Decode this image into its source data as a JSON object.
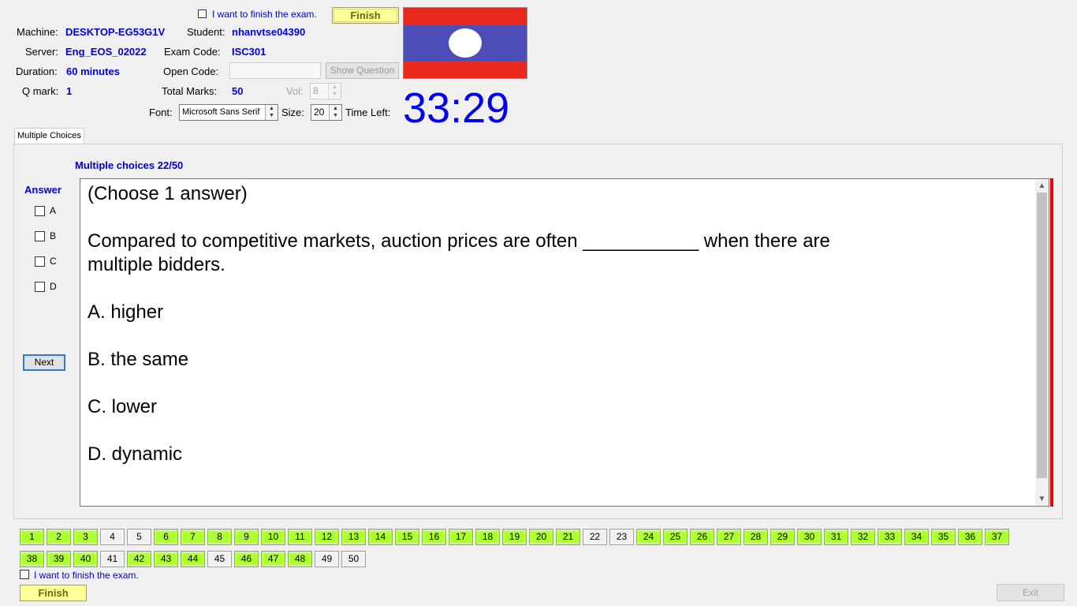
{
  "header": {
    "finish_checkbox_label": "I want to finish the exam.",
    "finish_label": "Finish",
    "machine_label": "Machine:",
    "machine_value": "DESKTOP-EG53G1V",
    "student_label": "Student:",
    "student_value": "nhanvtse04390",
    "server_label": "Server:",
    "server_value": "Eng_EOS_02022",
    "exam_code_label": "Exam Code:",
    "exam_code_value": "ISC301",
    "duration_label": "Duration:",
    "duration_value": "60 minutes",
    "open_code_label": "Open Code:",
    "open_code_value": "",
    "show_question_label": "Show Question",
    "q_mark_label": "Q mark:",
    "q_mark_value": "1",
    "total_marks_label": "Total Marks:",
    "total_marks_value": "50",
    "vol_label": "Vol:",
    "vol_value": "8",
    "font_label": "Font:",
    "font_value": "Microsoft Sans Serif",
    "size_label": "Size:",
    "size_value": "20",
    "time_left_label": "Time Left:",
    "timer": "33:29"
  },
  "tab": {
    "label": "Multiple Choices"
  },
  "question_panel": {
    "progress": "Multiple choices 22/50",
    "answer_title": "Answer",
    "answer_options": [
      "A",
      "B",
      "C",
      "D"
    ],
    "next_label": "Next",
    "instruction": "(Choose 1 answer)",
    "stem_line1": "Compared to competitive markets, auction prices are often ___________ when there are",
    "stem_line2": "multiple bidders.",
    "choices": [
      "A.  higher",
      "B.  the same",
      "C.  lower",
      "D.  dynamic"
    ]
  },
  "question_grid": {
    "items": [
      {
        "n": "1",
        "answered": true
      },
      {
        "n": "2",
        "answered": true
      },
      {
        "n": "3",
        "answered": true
      },
      {
        "n": "4",
        "answered": false
      },
      {
        "n": "5",
        "answered": false
      },
      {
        "n": "6",
        "answered": true
      },
      {
        "n": "7",
        "answered": true
      },
      {
        "n": "8",
        "answered": true
      },
      {
        "n": "9",
        "answered": true
      },
      {
        "n": "10",
        "answered": true
      },
      {
        "n": "11",
        "answered": true
      },
      {
        "n": "12",
        "answered": true
      },
      {
        "n": "13",
        "answered": true
      },
      {
        "n": "14",
        "answered": true
      },
      {
        "n": "15",
        "answered": true
      },
      {
        "n": "16",
        "answered": true
      },
      {
        "n": "17",
        "answered": true
      },
      {
        "n": "18",
        "answered": true
      },
      {
        "n": "19",
        "answered": true
      },
      {
        "n": "20",
        "answered": true
      },
      {
        "n": "21",
        "answered": true
      },
      {
        "n": "22",
        "answered": false
      },
      {
        "n": "23",
        "answered": false
      },
      {
        "n": "24",
        "answered": true
      },
      {
        "n": "25",
        "answered": true
      },
      {
        "n": "26",
        "answered": true
      },
      {
        "n": "27",
        "answered": true
      },
      {
        "n": "28",
        "answered": true
      },
      {
        "n": "29",
        "answered": true
      },
      {
        "n": "30",
        "answered": true
      },
      {
        "n": "31",
        "answered": true
      },
      {
        "n": "32",
        "answered": true
      },
      {
        "n": "33",
        "answered": true
      },
      {
        "n": "34",
        "answered": true
      },
      {
        "n": "35",
        "answered": true
      },
      {
        "n": "36",
        "answered": true
      },
      {
        "n": "37",
        "answered": true
      },
      {
        "n": "38",
        "answered": true
      },
      {
        "n": "39",
        "answered": true
      },
      {
        "n": "40",
        "answered": true
      },
      {
        "n": "41",
        "answered": false
      },
      {
        "n": "42",
        "answered": true
      },
      {
        "n": "43",
        "answered": true
      },
      {
        "n": "44",
        "answered": true
      },
      {
        "n": "45",
        "answered": false
      },
      {
        "n": "46",
        "answered": true
      },
      {
        "n": "47",
        "answered": true
      },
      {
        "n": "48",
        "answered": true
      },
      {
        "n": "49",
        "answered": false
      },
      {
        "n": "50",
        "answered": false
      }
    ]
  },
  "footer": {
    "finish_checkbox_label": "I want to finish the exam.",
    "finish_label": "Finish",
    "exit_label": "Exit"
  },
  "colors": {
    "answered": "#adff2f",
    "unanswered": "#f0f0f0",
    "accent_blue": "#0000dd",
    "timer": "#0000ee",
    "finish_bg": "#ffff99",
    "flag_red": "#e8291c",
    "flag_blue": "#4d4db8"
  }
}
